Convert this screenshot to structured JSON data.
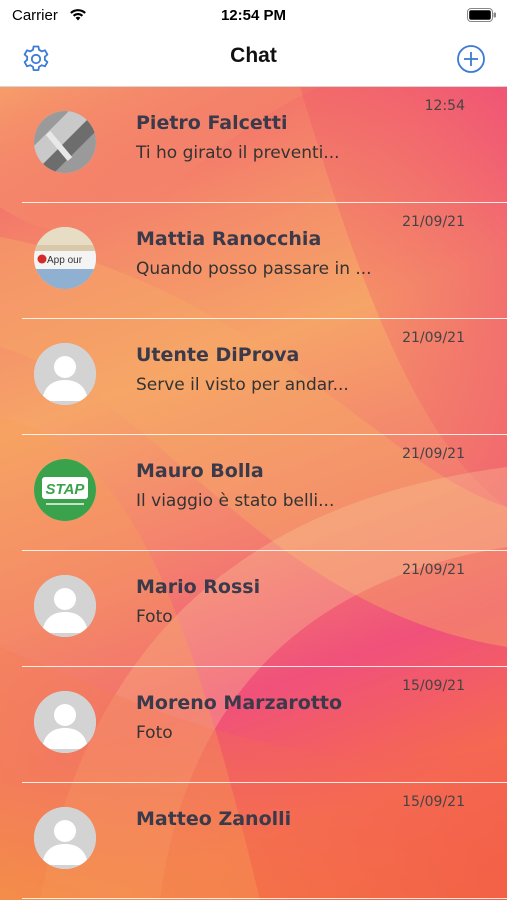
{
  "status_bar": {
    "carrier": "Carrier",
    "time": "12:54 PM",
    "wifi_icon": "wifi-icon",
    "battery_icon": "battery-icon"
  },
  "nav": {
    "title": "Chat",
    "left_icon": "gear-icon",
    "right_icon": "plus-circle-icon",
    "accent_color": "#3a7bd5"
  },
  "chats": [
    {
      "name": "Pietro Falcetti",
      "preview": "Ti ho girato il preventi...",
      "date": "12:54",
      "avatar": "photo"
    },
    {
      "name": "Mattia Ranocchia",
      "preview": "Quando posso passare in ...",
      "date": "21/09/21",
      "avatar": "appour-logo"
    },
    {
      "name": "Utente DiProva",
      "preview": "Serve il visto per andar...",
      "date": "21/09/21",
      "avatar": "default-person"
    },
    {
      "name": "Mauro Bolla",
      "preview": "Il viaggio è stato belli...",
      "date": "21/09/21",
      "avatar": "stap-logo"
    },
    {
      "name": "Mario Rossi",
      "preview": "Foto",
      "date": "21/09/21",
      "avatar": "default-person"
    },
    {
      "name": "Moreno Marzarotto",
      "preview": "Foto",
      "date": "15/09/21",
      "avatar": "default-person"
    },
    {
      "name": "Matteo Zanolli",
      "preview": "",
      "date": "15/09/21",
      "avatar": "default-person"
    }
  ],
  "logos": {
    "appour_text": "App our",
    "stap_text": "STAP"
  }
}
